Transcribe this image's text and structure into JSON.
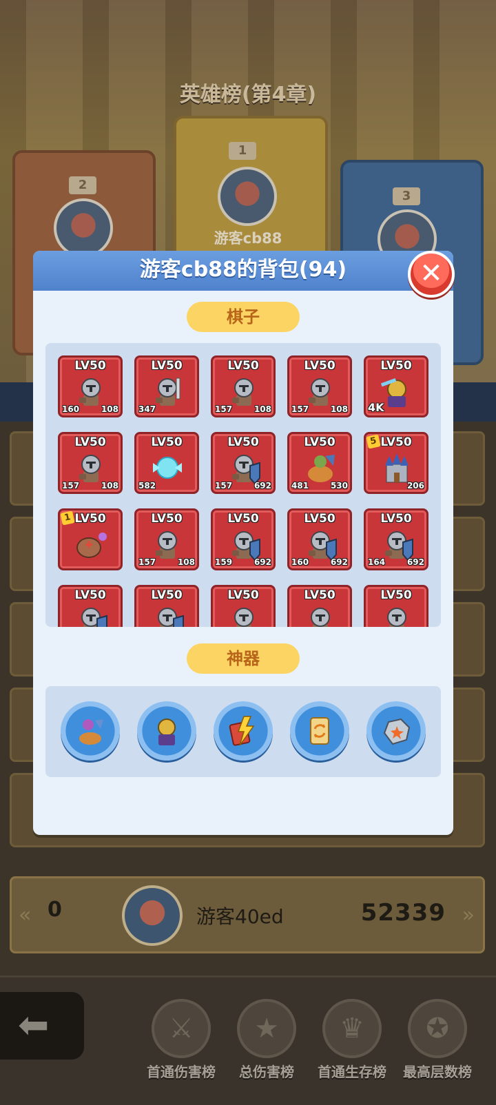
{
  "background": {
    "title": "英雄榜(第4章)",
    "top_ranks": [
      {
        "rank": "1",
        "name": "游客cb88"
      },
      {
        "rank": "2",
        "name": ""
      },
      {
        "rank": "3",
        "name": ""
      }
    ],
    "my_entry": {
      "rank": "0",
      "name": "游客40ed",
      "score": "52339"
    },
    "tabs": [
      {
        "label": "首通伤害榜",
        "icon": "swords-icon"
      },
      {
        "label": "总伤害榜",
        "icon": "star-medal-icon"
      },
      {
        "label": "首通生存榜",
        "icon": "crown-shield-icon"
      },
      {
        "label": "最高层数榜",
        "icon": "star-flag-icon"
      }
    ]
  },
  "modal": {
    "title": "游客cb88的背包(94)",
    "pieces_label": "棋子",
    "artifacts_label": "神器",
    "pieces": [
      {
        "level": "LV50",
        "icon": "knight-hammer-icon",
        "stat1": "160",
        "stat2": "108"
      },
      {
        "level": "LV50",
        "icon": "knight-sword-icon",
        "stat1": "347",
        "stat2": ""
      },
      {
        "level": "LV50",
        "icon": "knight-hammer-icon",
        "stat1": "157",
        "stat2": "108"
      },
      {
        "level": "LV50",
        "icon": "knight-hammer-icon",
        "stat1": "157",
        "stat2": "108"
      },
      {
        "level": "LV50",
        "icon": "golden-paladin-icon",
        "stat1": "4K",
        "stat2": ""
      },
      {
        "level": "LV50",
        "icon": "knight-hammer-icon",
        "stat1": "157",
        "stat2": "108"
      },
      {
        "level": "LV50",
        "icon": "ice-spirit-icon",
        "stat1": "582",
        "stat2": ""
      },
      {
        "level": "LV50",
        "icon": "knight-shield-icon",
        "stat1": "157",
        "stat2": "692"
      },
      {
        "level": "LV50",
        "icon": "dragon-rider-icon",
        "stat1": "481",
        "stat2": "530"
      },
      {
        "level": "LV50",
        "icon": "castle-icon",
        "stat1": "",
        "stat2": "206",
        "star": "5"
      },
      {
        "level": "LV50",
        "icon": "potion-bag-icon",
        "stat1": "",
        "stat2": "",
        "star": "1"
      },
      {
        "level": "LV50",
        "icon": "knight-hammer-icon",
        "stat1": "157",
        "stat2": "108"
      },
      {
        "level": "LV50",
        "icon": "knight-shield-icon",
        "stat1": "159",
        "stat2": "692"
      },
      {
        "level": "LV50",
        "icon": "knight-shield-icon",
        "stat1": "160",
        "stat2": "692"
      },
      {
        "level": "LV50",
        "icon": "knight-shield-icon",
        "stat1": "164",
        "stat2": "692"
      },
      {
        "level": "LV50",
        "icon": "knight-shield-icon",
        "stat1": "",
        "stat2": ""
      },
      {
        "level": "LV50",
        "icon": "knight-shield-icon",
        "stat1": "",
        "stat2": ""
      },
      {
        "level": "LV50",
        "icon": "knight-hammer-icon",
        "stat1": "",
        "stat2": ""
      },
      {
        "level": "LV50",
        "icon": "knight-hammer-icon",
        "stat1": "",
        "stat2": ""
      },
      {
        "level": "LV50",
        "icon": "knight-hammer-icon",
        "stat1": "",
        "stat2": ""
      }
    ],
    "artifacts": [
      {
        "icon": "archer-dragon-icon"
      },
      {
        "icon": "golden-paladin-icon"
      },
      {
        "icon": "lightning-cards-icon"
      },
      {
        "icon": "refresh-card-icon"
      },
      {
        "icon": "spark-stone-icon"
      }
    ]
  },
  "colors": {
    "piece_bg": "#c9363a",
    "pill_bg": "#fcd463",
    "pill_text": "#b8651a",
    "header_blue": "#4f82cc",
    "close_red": "#e0463a"
  }
}
